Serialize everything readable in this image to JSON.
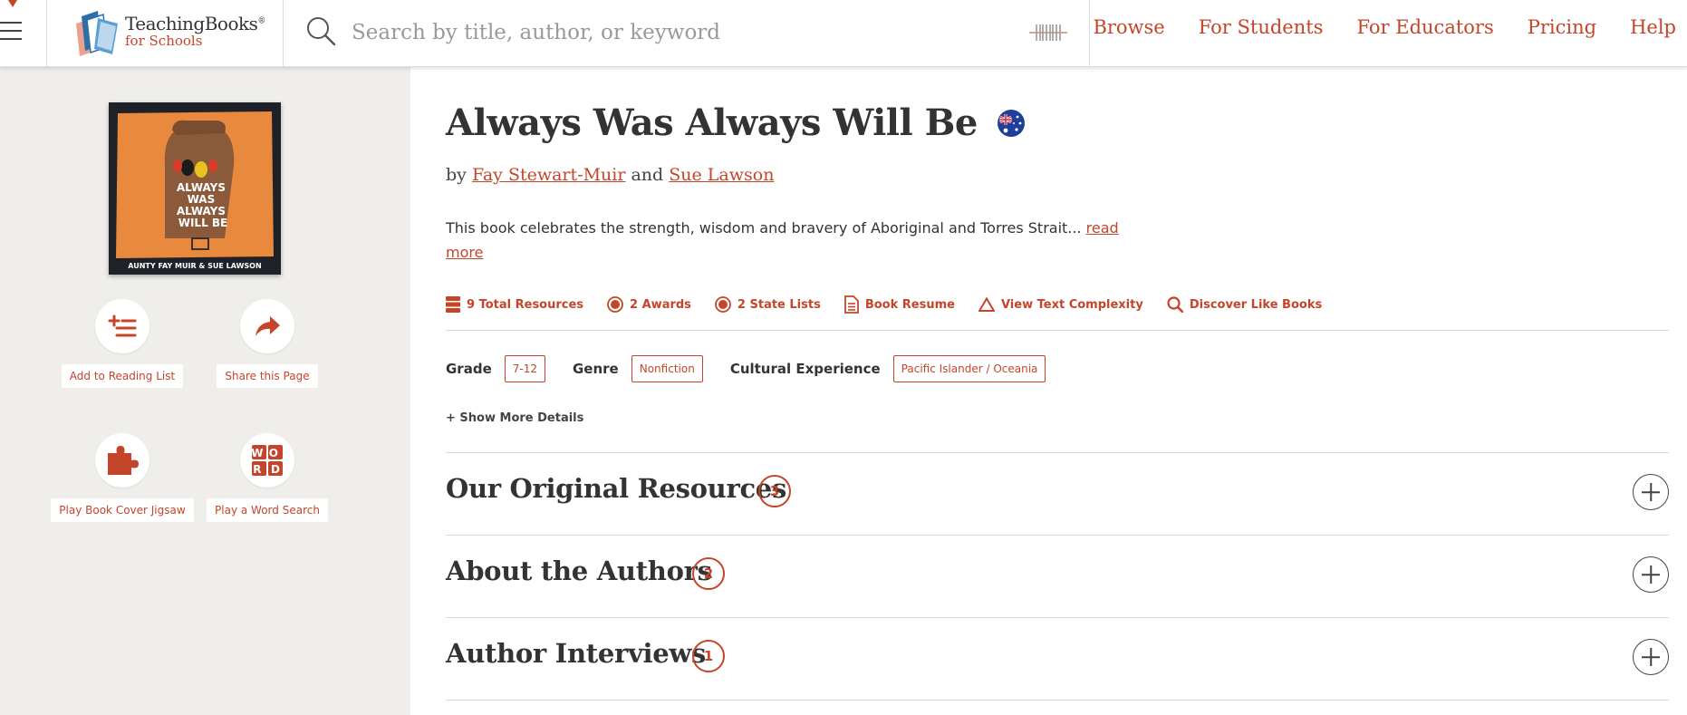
{
  "header": {
    "logo": {
      "line1": "TeachingBooks",
      "line2": "for Schools",
      "registered": "®"
    },
    "search": {
      "placeholder": "Search by title, author, or keyword",
      "value": ""
    },
    "nav": [
      "Browse",
      "For Students",
      "For Educators",
      "Pricing",
      "Help"
    ]
  },
  "book": {
    "title": "Always Was Always Will Be",
    "country_flag": "australia-flag-icon",
    "by_label": "by",
    "and_label": "and",
    "authors": [
      "Fay Stewart-Muir",
      "Sue Lawson"
    ],
    "description": "This book celebrates the strength, wisdom and bravery of Aboriginal and Torres Strait...",
    "read_more": "read more",
    "cover": {
      "title_lines": [
        "ALWAYS",
        "WAS",
        "ALWAYS",
        "WILL BE"
      ],
      "authors_line": "AUNTY FAY MUIR & SUE LAWSON",
      "colors": {
        "background": "#1e2228",
        "orange": "#e8893e",
        "fist": "#8a5a3b"
      }
    }
  },
  "quick_links": [
    {
      "icon": "stack-icon",
      "label": "9 Total Resources"
    },
    {
      "icon": "medal-icon",
      "label": "2 Awards"
    },
    {
      "icon": "medal-icon",
      "label": "2 State Lists"
    },
    {
      "icon": "document-icon",
      "label": "Book Resume"
    },
    {
      "icon": "triangle-icon",
      "label": "View Text Complexity"
    },
    {
      "icon": "search-icon",
      "label": "Discover Like Books"
    }
  ],
  "facets": [
    {
      "label": "Grade",
      "value": "7-12"
    },
    {
      "label": "Genre",
      "value": "Nonfiction"
    },
    {
      "label": "Cultural Experience",
      "value": "Pacific Islander / Oceania"
    }
  ],
  "show_more": "+ Show More Details",
  "sidebar_actions": [
    {
      "icon": "add-list-icon",
      "label": "Add to Reading List"
    },
    {
      "icon": "share-arrow-icon",
      "label": "Share this Page"
    },
    {
      "icon": "puzzle-icon",
      "label": "Play Book Cover Jigsaw"
    },
    {
      "icon": "word-search-icon",
      "label": "Play a Word Search",
      "icon_letters": [
        "W",
        "O",
        "R",
        "D"
      ]
    }
  ],
  "sections": [
    {
      "title": "Our Original Resources",
      "count": "3"
    },
    {
      "title": "About the Authors",
      "count": "2"
    },
    {
      "title": "Author Interviews",
      "count": "1"
    }
  ],
  "colors": {
    "accent": "#c4452a",
    "sidebar_bg": "#efeeea",
    "text": "#333333"
  }
}
